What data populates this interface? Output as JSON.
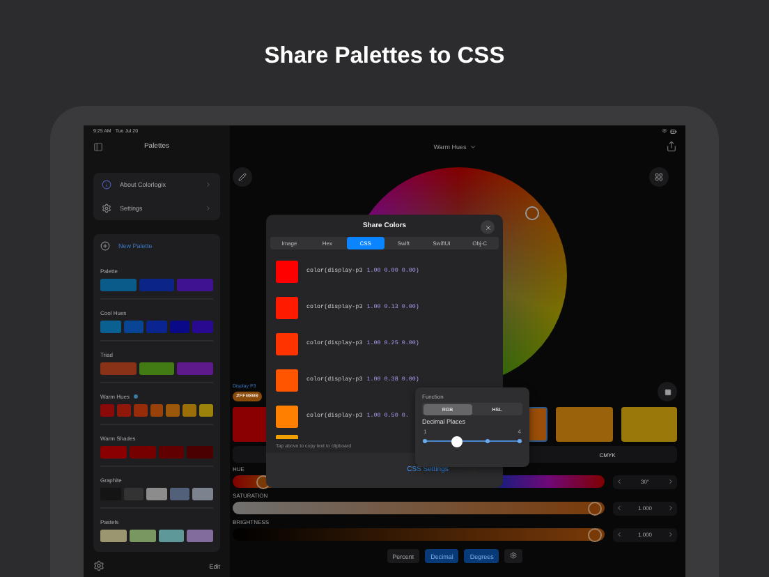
{
  "headline": "Share Palettes to CSS",
  "status_bar": {
    "time": "9:25 AM",
    "date": "Tue Jul 20"
  },
  "sidebar": {
    "title": "Palettes",
    "links": [
      {
        "kind": "about",
        "label": "About Colorlogix"
      },
      {
        "kind": "settings",
        "label": "Settings"
      }
    ],
    "new_palette": "New Palette",
    "palettes": [
      {
        "name": "Palette",
        "info": false,
        "colors": [
          {
            "color": "#0a5a8a"
          },
          {
            "color": "#0a2488"
          },
          {
            "color": "#3e1290"
          }
        ]
      },
      {
        "name": "Cool Hues",
        "info": false,
        "colors": [
          {
            "color": "#0a6090"
          },
          {
            "color": "#0a4494"
          },
          {
            "color": "#0a2490"
          },
          {
            "color": "#0a0a88"
          },
          {
            "color": "#280a90"
          }
        ]
      },
      {
        "name": "Triad",
        "info": false,
        "colors": [
          {
            "color": "#8a3218"
          },
          {
            "color": "#427a14"
          },
          {
            "color": "#5e1a8a"
          }
        ]
      },
      {
        "name": "Warm Hues",
        "info": true,
        "colors": [
          {
            "color": "#8a0a0a"
          },
          {
            "color": "#90180a"
          },
          {
            "color": "#962c0a"
          },
          {
            "color": "#98420a"
          },
          {
            "color": "#9c580a"
          },
          {
            "color": "#9c6e0a"
          },
          {
            "color": "#9c820a"
          }
        ]
      },
      {
        "name": "Warm Shades",
        "info": false,
        "colors": [
          {
            "color": "#8a0000"
          },
          {
            "color": "#760000"
          },
          {
            "color": "#600000"
          },
          {
            "color": "#4a0000"
          }
        ]
      },
      {
        "name": "Graphite",
        "info": false,
        "colors": [
          {
            "color": "#141414"
          },
          {
            "color": "#333333"
          },
          {
            "color": "#8c8c8c"
          },
          {
            "color": "#52607a"
          },
          {
            "color": "#7c828e"
          }
        ]
      },
      {
        "name": "Pastels",
        "info": false,
        "colors": [
          {
            "color": "#9c9670"
          },
          {
            "color": "#789860"
          },
          {
            "color": "#5e9898"
          },
          {
            "color": "#826c9e"
          }
        ]
      }
    ],
    "footer_button": "Edit"
  },
  "main": {
    "title": "Warm Hues",
    "color_space": "Display P3",
    "hex": "#FF0000",
    "swatches": [
      {
        "color": "#8a0000",
        "selected": false
      },
      {
        "color": "#9a4e08",
        "selected": true
      },
      {
        "color": "#9a620a",
        "selected": false
      },
      {
        "color": "#9a780a",
        "selected": false
      }
    ],
    "model_segment": "CMYK",
    "sliders": [
      {
        "kind": "hue",
        "label": "HUE",
        "level": 0.083,
        "reading": "30°"
      },
      {
        "kind": "saturation",
        "label": "SATURATION",
        "level": 1,
        "reading": "1.000"
      },
      {
        "kind": "brightness",
        "label": "BRIGHTNESS",
        "level": 1,
        "reading": "1.000"
      }
    ],
    "units": [
      {
        "label": "Percent",
        "selected": false
      },
      {
        "label": "Decimal",
        "selected": true
      },
      {
        "label": "Degrees",
        "selected": true
      }
    ]
  },
  "share_dialog": {
    "title": "Share Colors",
    "tabs": [
      {
        "label": "Image",
        "selected": false
      },
      {
        "label": "Hex",
        "selected": false
      },
      {
        "label": "CSS",
        "selected": true
      },
      {
        "label": "Swift",
        "selected": false
      },
      {
        "label": "SwiftUI",
        "selected": false
      },
      {
        "label": "Obj-C",
        "selected": false
      }
    ],
    "rows": [
      {
        "color": "#ff0000",
        "function": "color(display-p3",
        "values": "1.00 0.00 0.00)"
      },
      {
        "color": "#ff1a00",
        "function": "color(display-p3",
        "values": "1.00 0.13 0.00)"
      },
      {
        "color": "#ff3300",
        "function": "color(display-p3",
        "values": "1.00 0.25 0.00)"
      },
      {
        "color": "#ff5500",
        "function": "color(display-p3",
        "values": "1.00 0.38 0.00)"
      },
      {
        "color": "#ff8000",
        "function": "color(display-p3",
        "values": "1.00 0.50 0."
      }
    ],
    "hint": "Tap above to copy text to clipboard",
    "settings_link": "CSS Settings"
  },
  "css_settings": {
    "function_label": "Function",
    "functions": [
      {
        "label": "RGB",
        "selected": true
      },
      {
        "label": "HSL",
        "selected": false
      }
    ],
    "decimal_label": "Decimal Places",
    "min": "1",
    "max": "4",
    "level": 0.333
  }
}
